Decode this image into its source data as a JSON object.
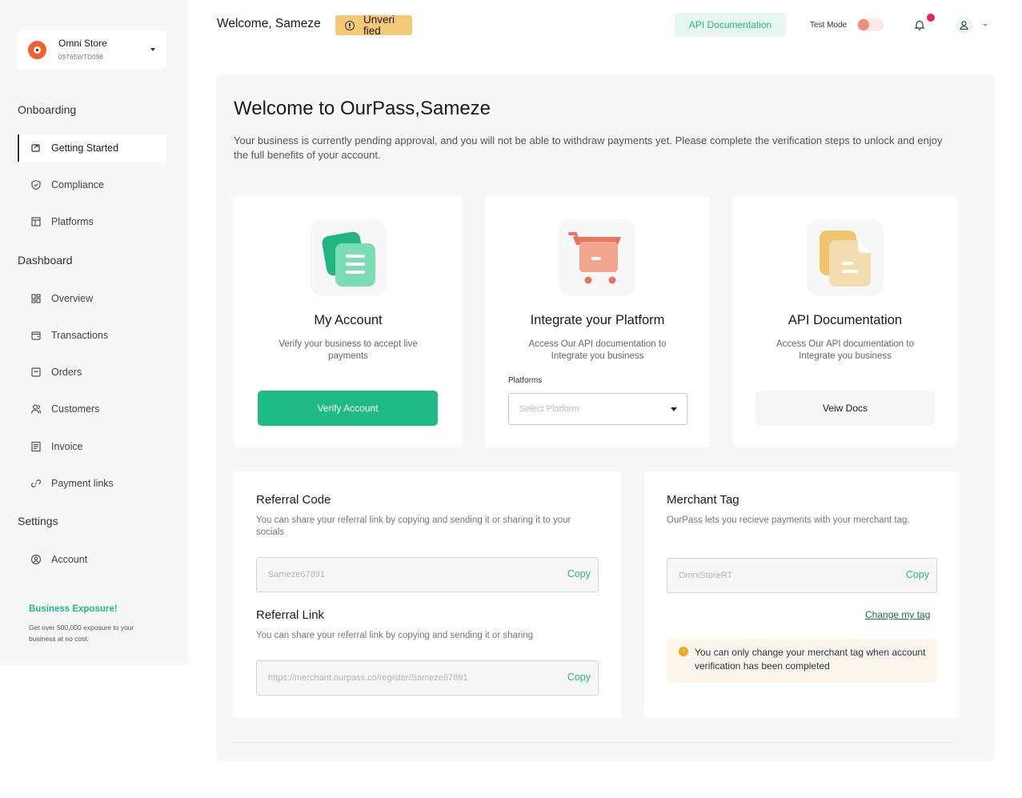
{
  "sidebar": {
    "store": {
      "name": "Omni Store",
      "id": "09765WTD098"
    },
    "sections": [
      {
        "title": "Onboarding"
      },
      {
        "title": "Dashboard"
      },
      {
        "title": "Settings"
      }
    ],
    "items": [
      {
        "label": "Getting  Started",
        "icon": "getting-started-icon"
      },
      {
        "label": "Compliance",
        "icon": "shield-icon"
      },
      {
        "label": "Platforms",
        "icon": "platform-icon"
      },
      {
        "label": "Overview",
        "icon": "grid-icon"
      },
      {
        "label": "Transactions",
        "icon": "wallet-icon"
      },
      {
        "label": "Orders",
        "icon": "bag-icon"
      },
      {
        "label": "Customers",
        "icon": "users-icon"
      },
      {
        "label": "Invoice",
        "icon": "document-icon"
      },
      {
        "label": "Payment links",
        "icon": "link-icon"
      },
      {
        "label": "Account",
        "icon": "account-icon"
      }
    ],
    "promo": {
      "title": "Business Exposure!",
      "text": "Get over 500,000 exposure to your business at no cost."
    }
  },
  "header": {
    "welcome": "Welcome, Sameze",
    "status_badge": "Unveri fied",
    "api_docs": "API Documentation",
    "test_mode": "Test Mode"
  },
  "main": {
    "title": "Welcome to OurPass,Sameze",
    "description": "Your business is currently pending approval, and you will not be able to withdraw payments yet. Please complete the verification steps to unlock and enjoy the full benefits of your account.",
    "cards": [
      {
        "title": "My Account",
        "desc": "Verify your business to accept live payments",
        "button": "Verify Account"
      },
      {
        "title": "Integrate your Platform",
        "desc": "Access Our API documentation to Integrate you business",
        "select_label": "Platforms",
        "select_placeholder": "Select Platform"
      },
      {
        "title": "API Documentation",
        "desc": "Access Our API documentation to Integrate you business",
        "button": "Veiw Docs"
      }
    ],
    "referral": {
      "code_title": "Referral Code",
      "code_desc": "You can share your referral link by copying and sending it or sharing it to your socials",
      "code_value": "Sameze67891",
      "link_title": "Referral Link",
      "link_desc": "You can share your referral link by copying and sending it or sharing",
      "link_value": "https://merchant.ourpass.co/register/Sameze67891",
      "copy": "Copy"
    },
    "merchant": {
      "title": "Merchant Tag",
      "desc": "OurPass lets you recieve payments with your merchant tag.",
      "value": "OmniStoreRT",
      "copy": "Copy",
      "change": "Change my tag",
      "notice": "You can only change your merchant tag when account verification has been completed"
    }
  },
  "colors": {
    "accent": "#1fba85",
    "warning": "#f5c97a",
    "brand_orange": "#f3622d",
    "alert_dot": "#f0224e"
  }
}
